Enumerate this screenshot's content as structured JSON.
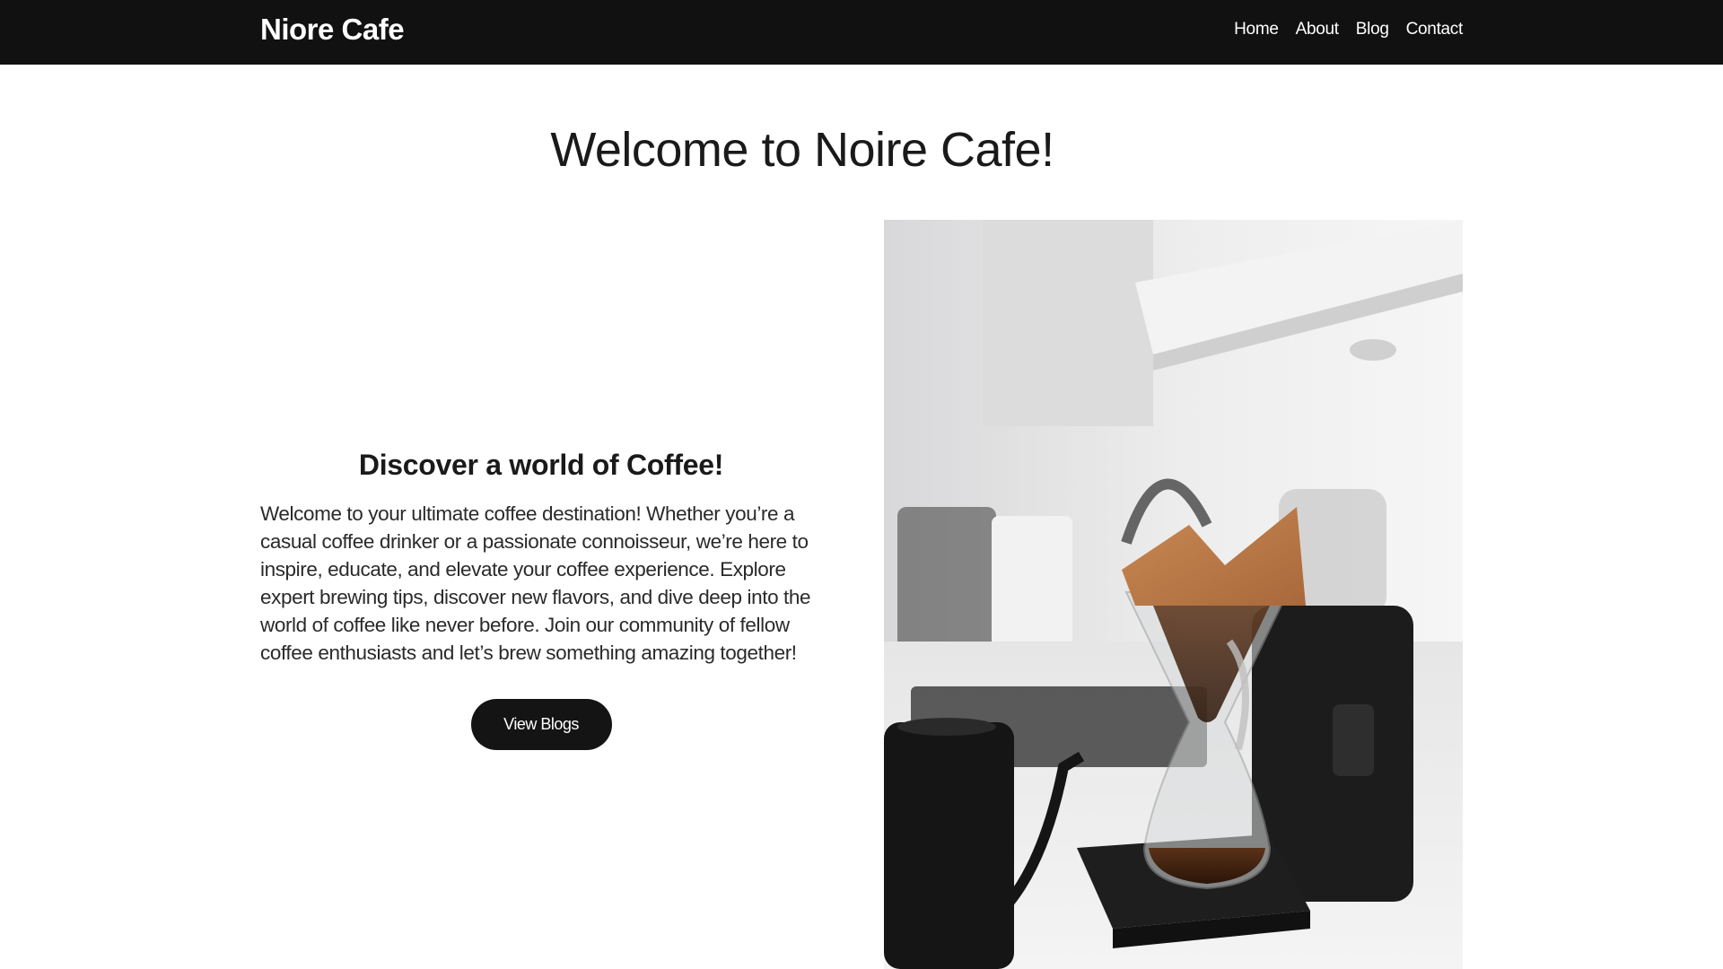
{
  "nav": {
    "brand": "Niore Cafe",
    "links": [
      "Home",
      "About",
      "Blog",
      "Contact"
    ]
  },
  "main": {
    "title": "Welcome to Noire Cafe!",
    "intro": {
      "heading": "Discover a world of Coffee!",
      "body": "Welcome to your ultimate coffee destination! Whether you’re a casual coffee drinker or a passionate connoisseur, we’re here to inspire, educate, and elevate your coffee experience. Explore expert brewing tips, discover new flavors, and dive deep into the world of coffee like never before. Join our community of fellow coffee enthusiasts and let’s brew something amazing together!",
      "button_label": "View Blogs"
    }
  },
  "hero_image": {
    "icon": "coffee-pour-over-photo"
  },
  "colors": {
    "navbar": "#111111",
    "button": "#141414",
    "text": "#1a1a1a",
    "background": "#ffffff"
  }
}
